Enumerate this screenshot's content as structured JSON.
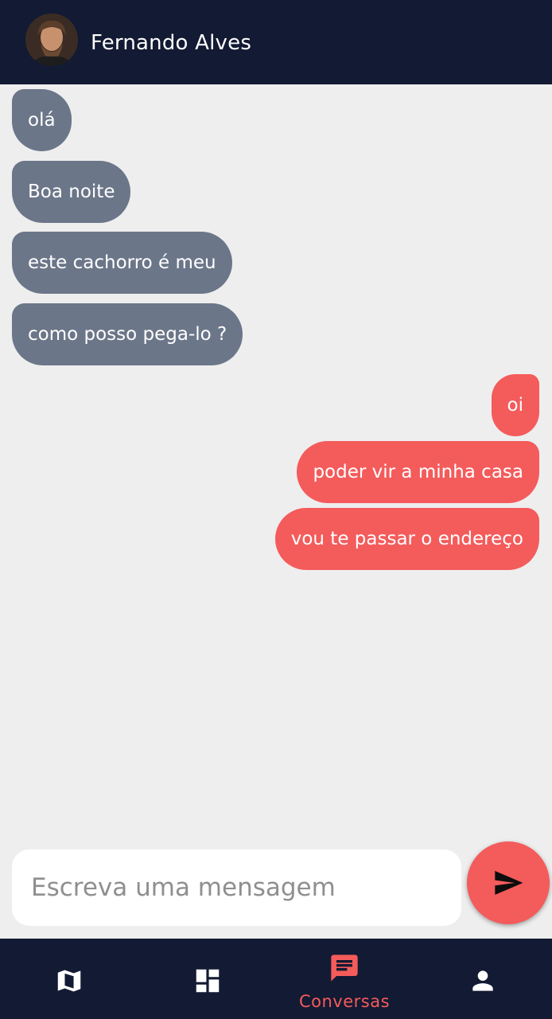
{
  "contact": {
    "name": "Fernando Alves",
    "avatar_icon": "contact-avatar"
  },
  "messages": [
    {
      "text": "olá",
      "direction": "incoming"
    },
    {
      "text": "Boa noite",
      "direction": "incoming"
    },
    {
      "text": "este cachorro é meu",
      "direction": "incoming"
    },
    {
      "text": "como posso pega-lo ?",
      "direction": "incoming"
    },
    {
      "text": "oi",
      "direction": "outgoing"
    },
    {
      "text": "poder vir a minha casa",
      "direction": "outgoing"
    },
    {
      "text": "vou te passar o endereço",
      "direction": "outgoing"
    }
  ],
  "composer": {
    "placeholder": "Escreva uma mensagem",
    "value": "",
    "send_icon": "send-icon"
  },
  "nav": {
    "items": [
      {
        "icon": "map-icon",
        "label": "",
        "active": false
      },
      {
        "icon": "dashboard-icon",
        "label": "",
        "active": false
      },
      {
        "icon": "chat-icon",
        "label": "Conversas",
        "active": true
      },
      {
        "icon": "person-icon",
        "label": "",
        "active": false
      }
    ]
  },
  "colors": {
    "header_bg": "#131a33",
    "incoming_bubble": "#6c7689",
    "outgoing_bubble": "#f45b5b",
    "background": "#eeeeee",
    "accent": "#f45b5b"
  }
}
